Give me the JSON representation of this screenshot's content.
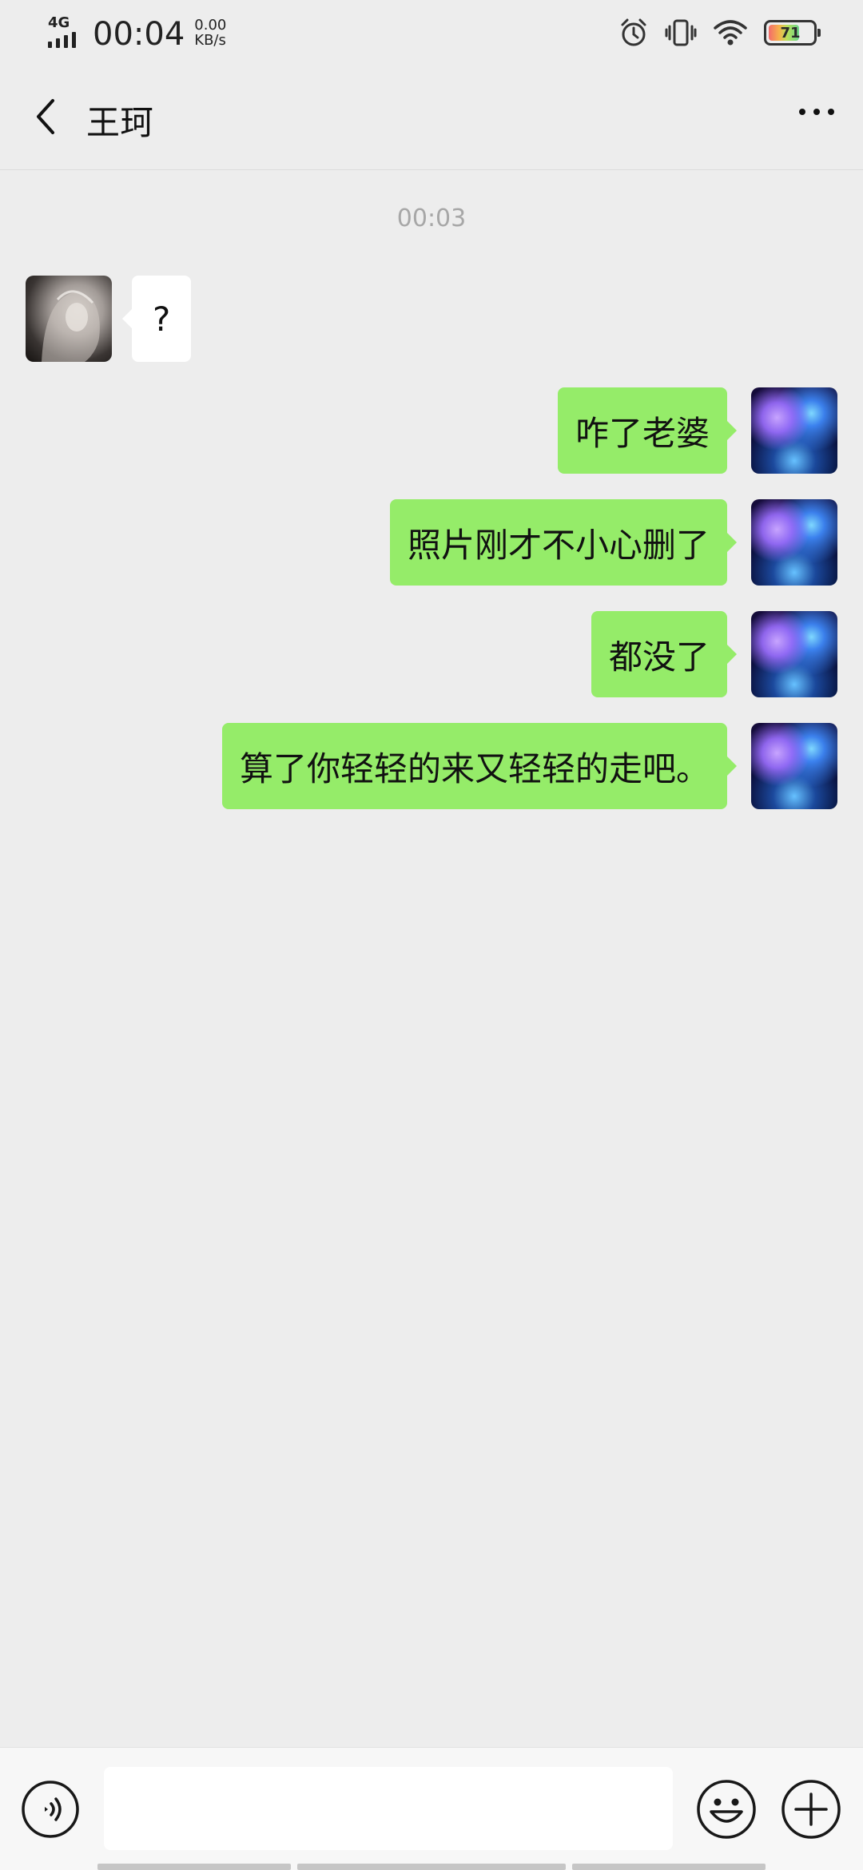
{
  "status_bar": {
    "network": "4G",
    "time": "00:04",
    "speed_value": "0.00",
    "speed_unit": "KB/s",
    "battery": "71",
    "battery_fraction": 0.71,
    "icons": [
      "alarm-icon",
      "vibrate-icon",
      "wifi-icon",
      "battery-icon"
    ]
  },
  "header": {
    "title": "王珂",
    "back_icon": "chevron-left-icon",
    "more_icon": "more-dots-icon"
  },
  "chat": {
    "timestamp": "00:03",
    "messages": [
      {
        "from": "her",
        "text": "?"
      },
      {
        "from": "me",
        "text": "咋了老婆"
      },
      {
        "from": "me",
        "text": "照片刚才不小心删了"
      },
      {
        "from": "me",
        "text": "都没了"
      },
      {
        "from": "me",
        "text": "算了你轻轻的来又轻轻的走吧。"
      }
    ]
  },
  "input_bar": {
    "placeholder": "",
    "voice_icon": "voice-icon",
    "emoji_icon": "emoji-icon",
    "plus_icon": "plus-icon"
  },
  "colors": {
    "background": "#ededed",
    "bubble_me": "#95ec69",
    "bubble_her": "#ffffff",
    "timestamp": "#a7a7a7"
  }
}
